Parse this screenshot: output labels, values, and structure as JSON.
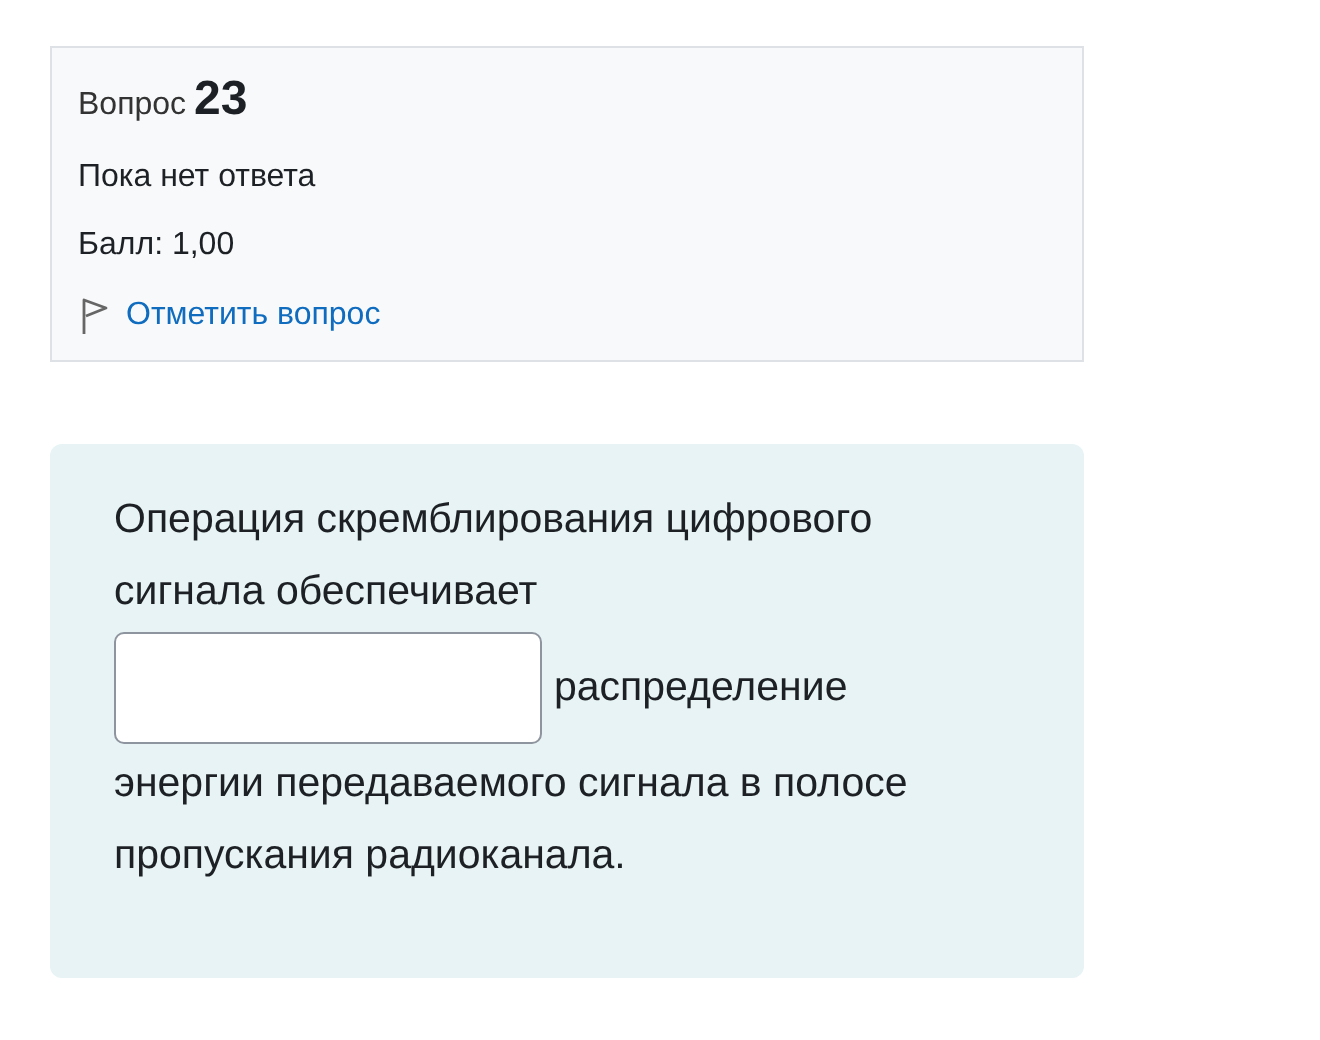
{
  "info": {
    "label": "Вопрос",
    "number": "23",
    "status": "Пока нет ответа",
    "grade": "Балл: 1,00",
    "flag_link": "Отметить вопрос",
    "flagged": false
  },
  "question": {
    "text_before": "Операция скремблирования цифрового сигнала обеспечивает",
    "text_after_field": "распределение",
    "text_end": "энергии передаваемого сигнала в полосе пропускания радиоканала."
  }
}
